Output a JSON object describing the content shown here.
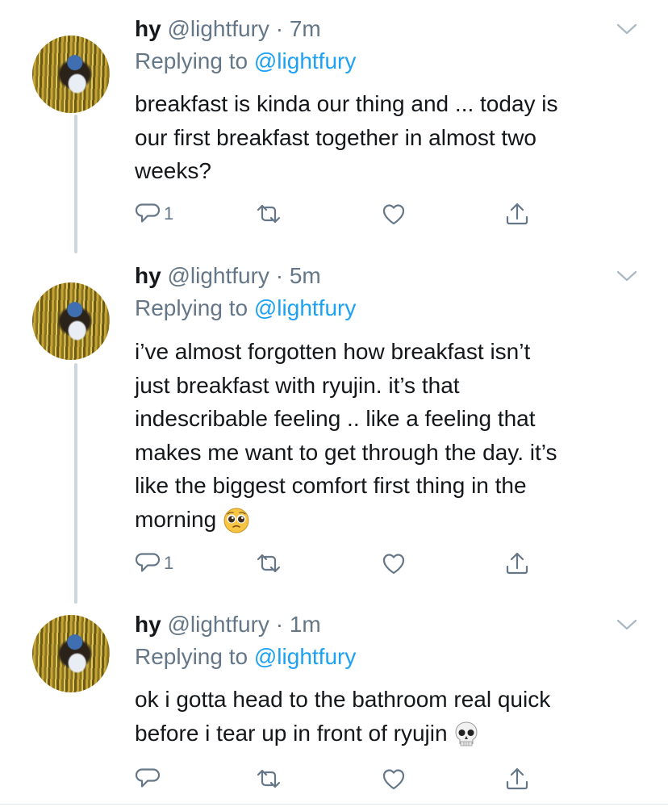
{
  "tweets": [
    {
      "name": "hy",
      "handle": "@lightfury",
      "sep": "·",
      "time": "7m",
      "replying_prefix": "Replying to",
      "replying_handle": "@lightfury",
      "lines": [
        "breakfast is kinda our thing and ... today is",
        "our first breakfast together in almost two",
        "weeks?"
      ],
      "reply_count": "1",
      "emoji": ""
    },
    {
      "name": "hy",
      "handle": "@lightfury",
      "sep": "·",
      "time": "5m",
      "replying_prefix": "Replying to",
      "replying_handle": "@lightfury",
      "lines": [
        "i’ve almost forgotten how breakfast isn’t",
        "just breakfast with ryujin. it’s that",
        "indescribable feeling .. like a feeling that",
        "makes me want to get through the day. it’s",
        "like the biggest comfort first thing in the",
        "morning"
      ],
      "reply_count": "1",
      "emoji": "pleading-face"
    },
    {
      "name": "hy",
      "handle": "@lightfury",
      "sep": "·",
      "time": "1m",
      "replying_prefix": "Replying to",
      "replying_handle": "@lightfury",
      "lines": [
        "ok i gotta head to the bathroom real quick",
        "before i tear up in front of ryujin"
      ],
      "reply_count": "",
      "emoji": "skull"
    }
  ],
  "icons": [
    "chevron-down-icon",
    "reply-icon",
    "retweet-icon",
    "like-icon",
    "share-icon"
  ],
  "colors": {
    "link": "#1da1f2",
    "muted": "#657786",
    "text": "#14171a",
    "thread_line": "#ccd6dd"
  }
}
